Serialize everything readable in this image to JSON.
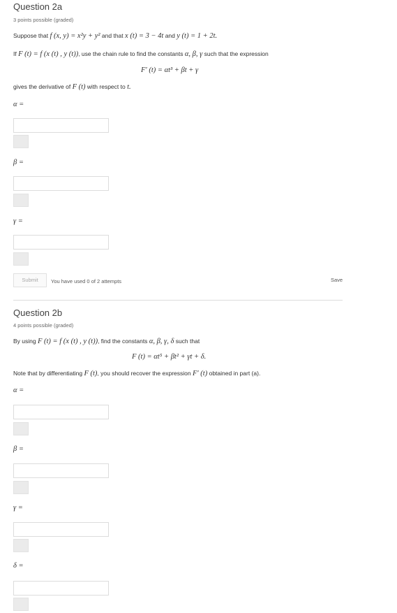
{
  "q2a": {
    "title": "Question 2a",
    "points": "3 points possible (graded)",
    "line1_a": "Suppose that",
    "f_def": "f (x, y) = x²y + y²",
    "line1_b": "and that",
    "x_def": "x (t) = 3 − 4t",
    "line1_c": "and",
    "y_def": "y (t) = 1 + 2t.",
    "line2_a": "If",
    "F_def": "F (t) = f (x (t) , y (t))",
    "line2_b": ", use the chain rule to find the constants",
    "consts": "α, β, γ",
    "line2_c": "such that the expression",
    "display": "F′ (t) = αt³ + βt + γ",
    "line3_a": "gives the derivative of",
    "line3_F": "F (t)",
    "line3_b": "with respect to",
    "line3_t": "t.",
    "labels": [
      "α =",
      "β =",
      "γ ="
    ],
    "submit": "Submit",
    "attempts": "You have used 0 of 2 attempts",
    "save": "Save"
  },
  "q2b": {
    "title": "Question 2b",
    "points": "4 points possible (graded)",
    "line1_a": "By using",
    "F_def": "F (t) = f (x (t) , y (t))",
    "line1_b": ", find the constants",
    "consts": "α, β, γ, δ",
    "line1_c": "such that",
    "display": "F (t) = αt⁵ + βt² + γt + δ.",
    "line2_a": "Note that by differentiating",
    "line2_F": "F (t)",
    "line2_b": ", you should recover the expression",
    "line2_Fp": "F′ (t)",
    "line2_c": "obtained in part (a).",
    "labels": [
      "α =",
      "β =",
      "γ =",
      "δ ="
    ]
  }
}
